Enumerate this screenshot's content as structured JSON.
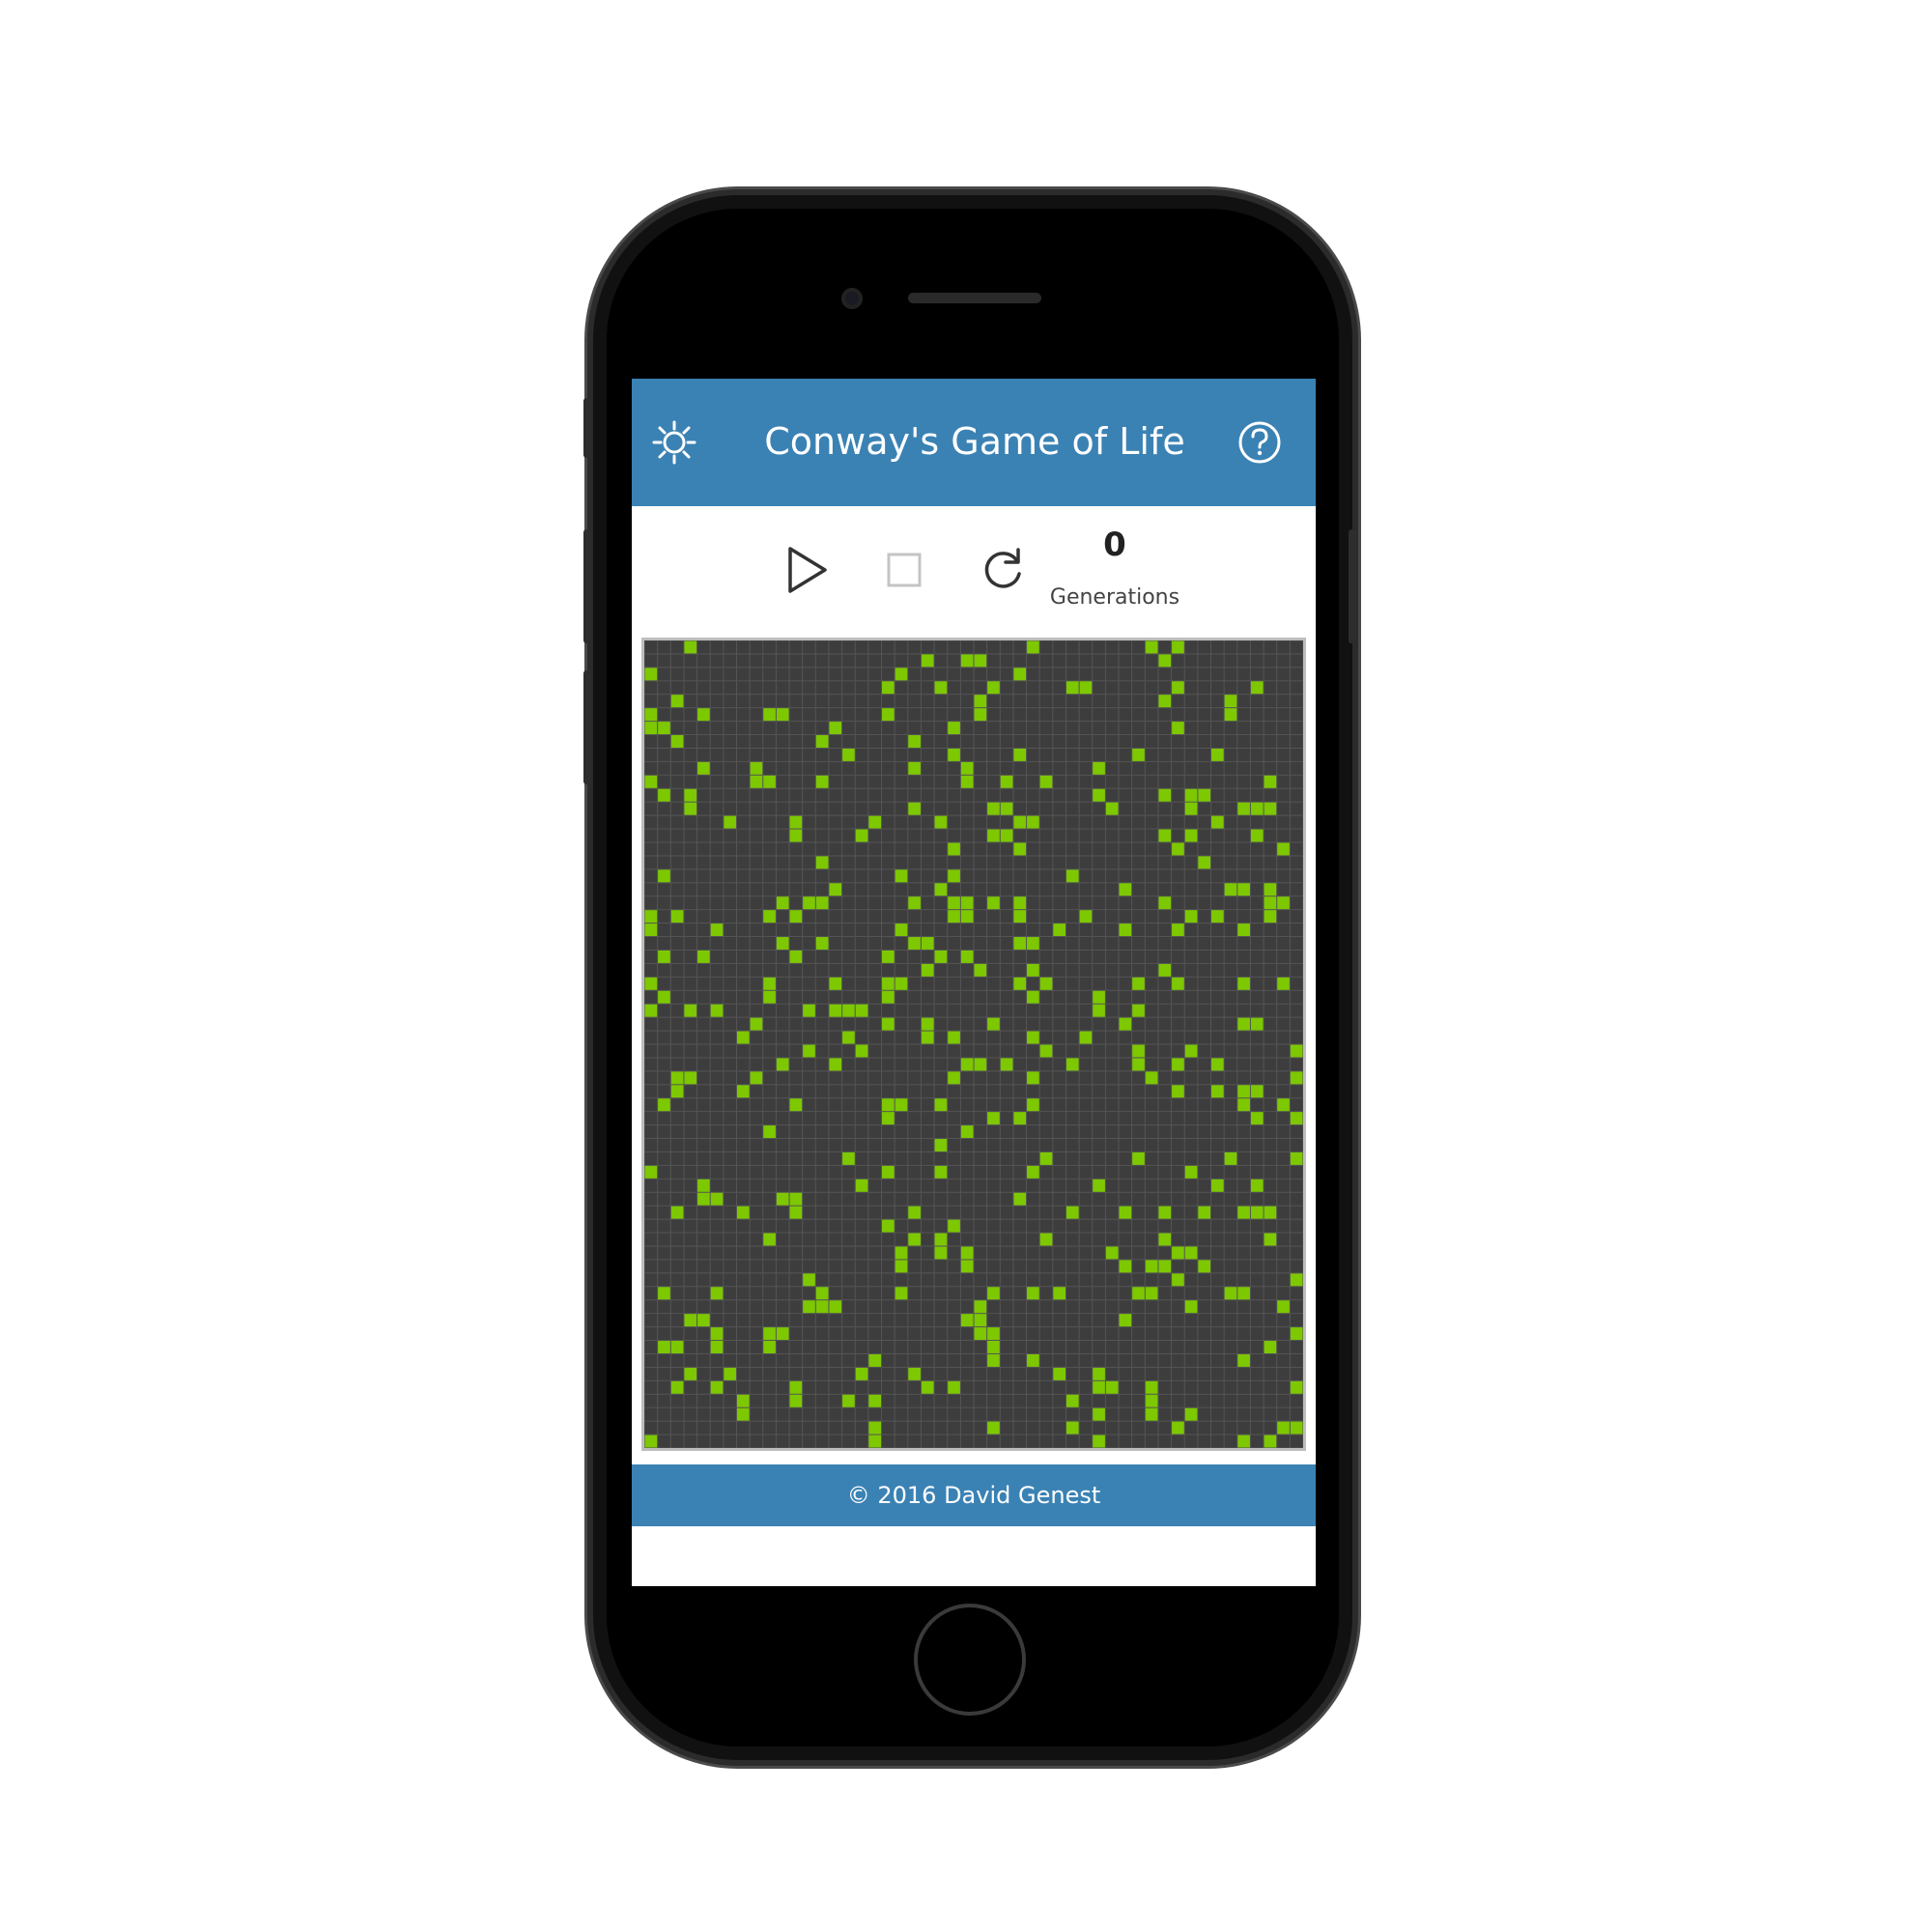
{
  "header": {
    "title": "Conway's Game of Life",
    "settings_icon": "gear-icon",
    "help_icon": "help-circle-icon"
  },
  "controls": {
    "play_icon": "play-icon",
    "stop_icon": "stop-icon",
    "reset_icon": "refresh-icon",
    "generation_count": "0",
    "generation_label": "Generations"
  },
  "board": {
    "columns": 50,
    "rows": 60,
    "live_color": "#7dc800",
    "dead_color": "#3d3d3d",
    "grid_color": "#555555",
    "seed": 20160
  },
  "footer": {
    "text": "© 2016 David Genest"
  },
  "colors": {
    "accent": "#3b82b4"
  }
}
